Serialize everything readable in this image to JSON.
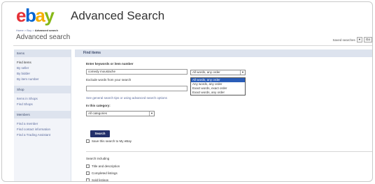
{
  "header": {
    "logo_letters": [
      "e",
      "b",
      "a",
      "y"
    ],
    "title": "Advanced Search",
    "breadcrumb": [
      "Home",
      "Buy",
      "Advanced search"
    ],
    "breadcrumb_sep": ">",
    "page_title": "Advanced search",
    "saved_searches_label": "Saved searches",
    "saved_searches_value": "",
    "go_label": "Go"
  },
  "sidebar": {
    "sections": [
      {
        "heading": "Items",
        "items": [
          "Find items",
          "By seller",
          "By bidder",
          "By item number"
        ]
      },
      {
        "heading": "Shop",
        "items": [
          "Items in Shops",
          "Find Shops"
        ]
      },
      {
        "heading": "Members",
        "items": [
          "Find a member",
          "Find contact information",
          "Find a Trading Assistant"
        ]
      }
    ]
  },
  "main": {
    "heading": "Find items",
    "keywords_label": "Enter keywords or item number",
    "keywords_value": "comedy moustache",
    "keyword_mode_selected": "All words, any order",
    "keyword_mode_options": [
      "All words, any order",
      "Any words, any order",
      "Exact words, exact order",
      "Exact words, any order"
    ],
    "exclude_label": "Exclude words from your search",
    "exclude_value": "",
    "tips_text": "See general search tips or using advanced search options",
    "category_label": "In this category:",
    "category_value": "All categories",
    "search_button": "Search",
    "save_search_label": "Save this search to My eBay",
    "search_including_label": "Search including",
    "including_options": [
      "Title and description",
      "Completed listings",
      "Sold listings"
    ]
  },
  "colors": {
    "ebay_e": "#e53238",
    "ebay_b": "#0064d2",
    "ebay_a": "#f5af02",
    "ebay_y": "#86b817",
    "button_bg": "#23306b",
    "section_head_bg": "#dde3ee",
    "selected_option_bg": "#2a5db8"
  }
}
